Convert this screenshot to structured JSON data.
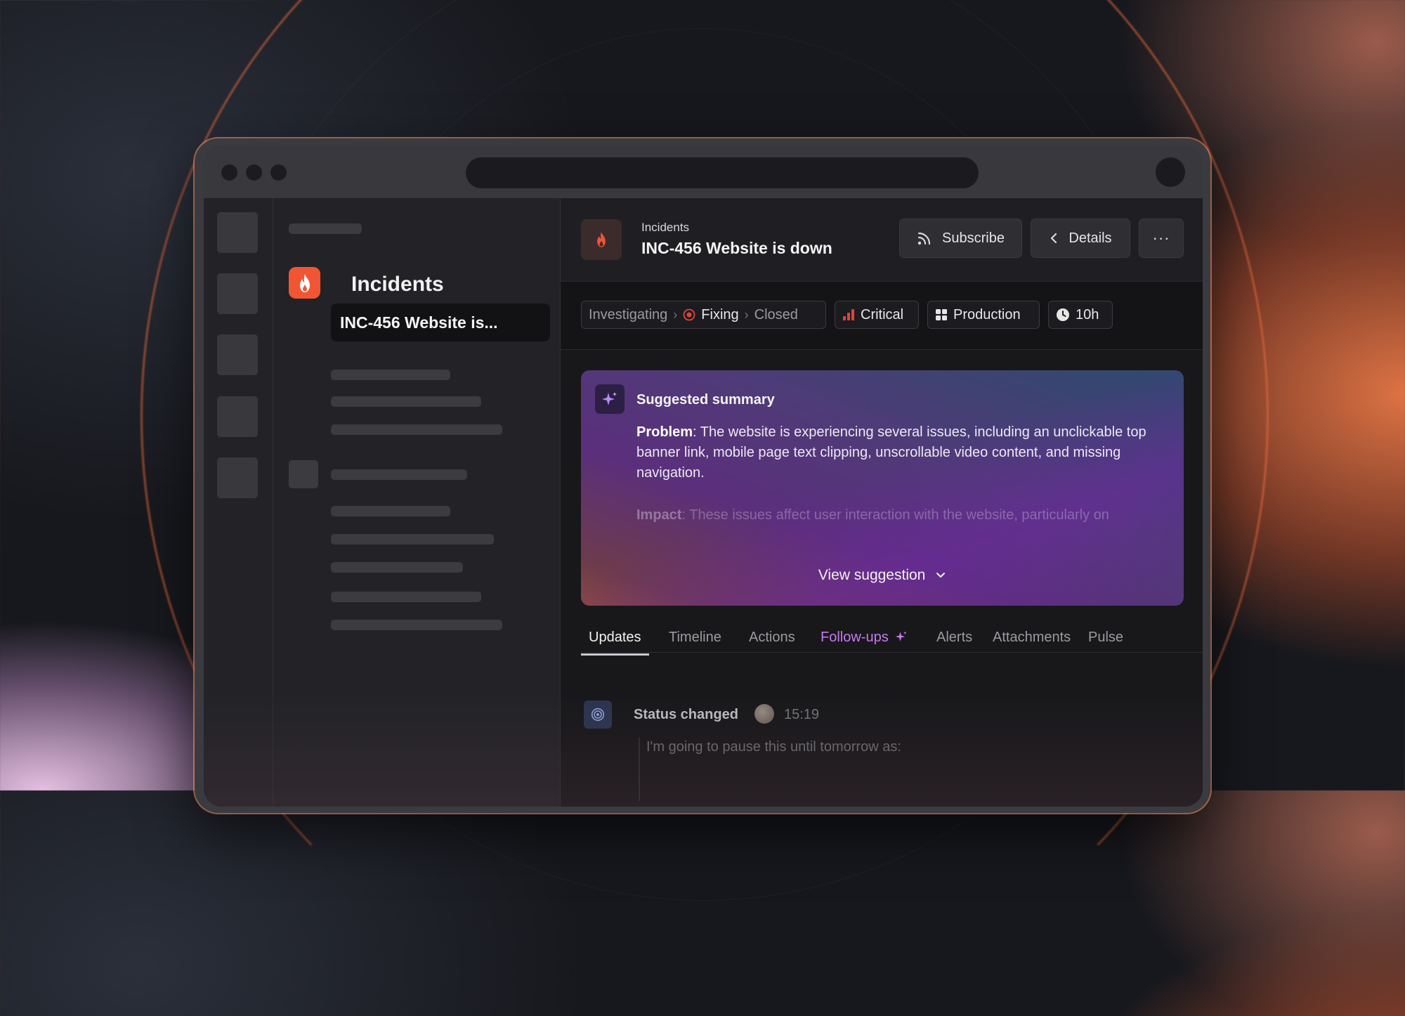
{
  "sidebar": {
    "title": "Incidents",
    "selected_item": "INC-456 Website is..."
  },
  "header": {
    "breadcrumb": "Incidents",
    "title": "INC-456 Website is down",
    "subscribe_label": "Subscribe",
    "details_label": "Details",
    "more_label": "···"
  },
  "status": {
    "stages": [
      "Investigating",
      "Fixing",
      "Closed"
    ],
    "severity": "Critical",
    "environment": "Production",
    "duration": "10h"
  },
  "summary": {
    "heading": "Suggested summary",
    "problem_label": "Problem",
    "problem_text": ": The website is experiencing several issues, including an unclickable top banner link, mobile page text clipping, unscrollable video content, and missing navigation.",
    "impact_label": "Impact",
    "impact_text": ": These issues affect user interaction with the website, particularly on",
    "view_label": "View suggestion"
  },
  "tabs": [
    "Updates",
    "Timeline",
    "Actions",
    "Follow-ups",
    "Alerts",
    "Attachments",
    "Pulse"
  ],
  "update": {
    "title": "Status changed",
    "time": "15:19",
    "text": "I'm going to pause this until tomorrow as:"
  },
  "colors": {
    "accent_orange": "#f25533",
    "critical_red": "#e0443a",
    "followups_purple": "#c779f0"
  }
}
